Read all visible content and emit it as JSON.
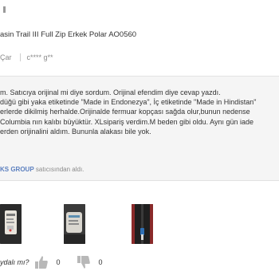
{
  "product": {
    "title": "asin Trail III Full Zip Erkek Polar AO0560"
  },
  "review": {
    "rating_label": "Çar",
    "author": "c**** g**",
    "lines": [
      "m. Satıcıya orijinal mi diye sordum. Orijinal efendim diye cevap yazdı.",
      "düğü gibi yaka etiketinde \"Made in Endonezya\", İç etiketinde \"Made in Hindistan\"",
      "erlerde dikilmiş herhalde.Orijinalde fermuar kopçası sağda olur,bunun nedense",
      "Columbia nın kalıbı büyüktür. XLsipariş verdim.M beden gibi oldu. Aynı gün iade",
      "erden orijinalini aldım. Bununla alakası bile yok."
    ],
    "seller_name": "KS GROUP",
    "seller_suffix": "satıcısından aldı."
  },
  "helpful": {
    "question": "ydalı mı?",
    "like_count": "0",
    "dislike_count": "0"
  },
  "colors": {
    "seller_link": "#5b7fbf",
    "panel_bg": "#f5f5f5",
    "icon_gray": "#b8b8b8"
  },
  "icons": {
    "like": "thumbs-up-icon",
    "dislike": "thumbs-down-icon"
  }
}
